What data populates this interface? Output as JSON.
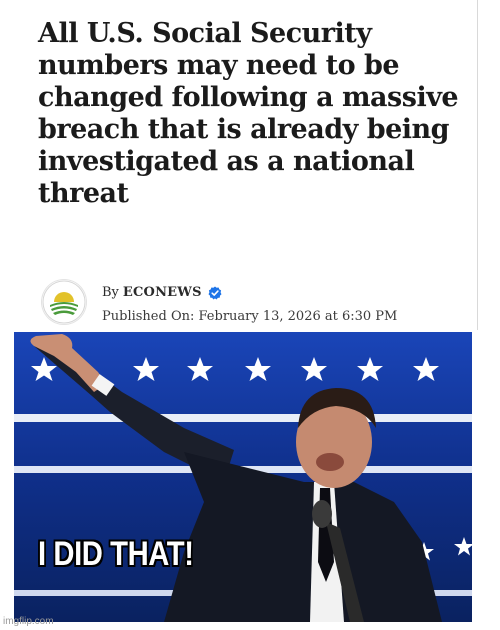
{
  "article": {
    "headline": "All U.S. Social Security numbers may need to be changed following a massive breach that is already being investigated as a national threat",
    "byline_prefix": "By",
    "author": "ECONEWS",
    "published": "Published On: February 13, 2026 at 6:30 PM",
    "verified_icon": "verified-check-icon",
    "logo_icon": "sunrise-fields-logo-icon"
  },
  "meme": {
    "caption": "I DID THAT!"
  },
  "watermark": {
    "text": "imgflip.com"
  },
  "colors": {
    "headline": "#1b1b1b",
    "verified_badge": "#1d74e8",
    "logo_green": "#4a9b3b",
    "logo_yellow": "#e2c22a",
    "backdrop_blue": "#0d2a78",
    "caption_text": "#ffffff",
    "caption_outline": "#000000"
  }
}
